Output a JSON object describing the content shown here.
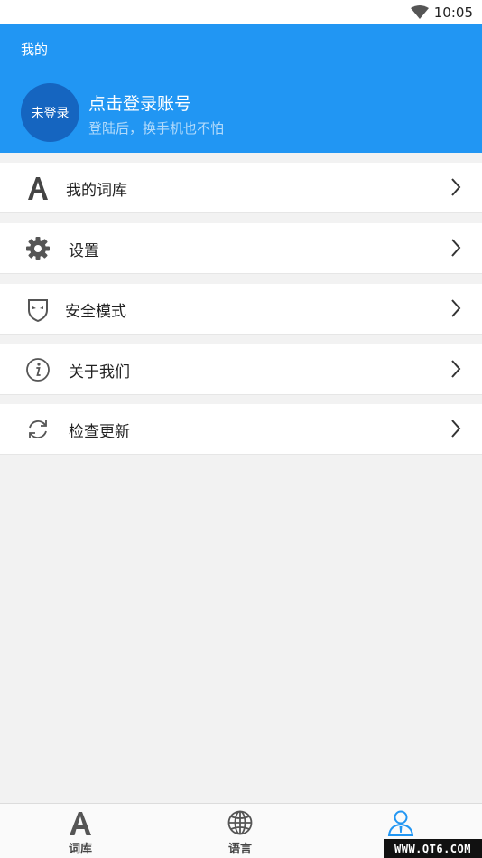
{
  "status_bar": {
    "time": "10:05",
    "wifi_icon": "wifi-icon"
  },
  "header": {
    "title": "我的",
    "avatar_text": "未登录",
    "login_title": "点击登录账号",
    "login_subtitle": "登陆后，换手机也不怕",
    "bg_color": "#2196f3"
  },
  "menu": [
    {
      "label": "我的词库",
      "icon": "letter-a-icon"
    },
    {
      "label": "设置",
      "icon": "gear-icon"
    },
    {
      "label": "安全模式",
      "icon": "mask-shield-icon"
    },
    {
      "label": "关于我们",
      "icon": "info-icon"
    },
    {
      "label": "检查更新",
      "icon": "refresh-icon"
    }
  ],
  "bottom_nav": [
    {
      "label": "词库",
      "icon": "letter-a-icon",
      "active": false
    },
    {
      "label": "语言",
      "icon": "globe-icon",
      "active": false
    },
    {
      "label": "",
      "icon": "person-icon",
      "active": true
    }
  ],
  "watermark": "WWW.QT6.COM"
}
